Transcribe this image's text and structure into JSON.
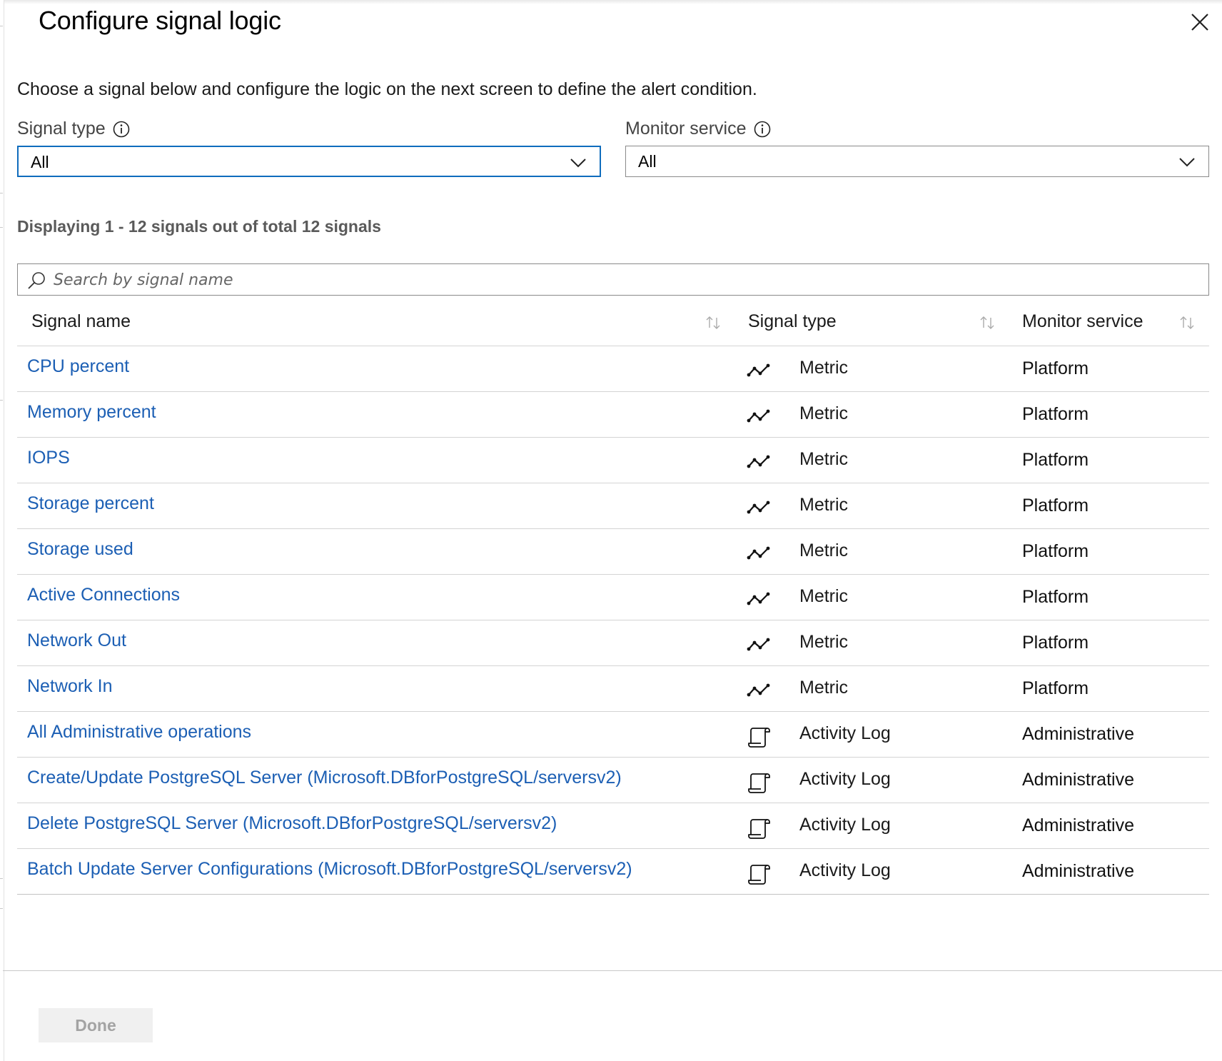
{
  "panel": {
    "title": "Configure signal logic",
    "intro": "Choose a signal below and configure the logic on the next screen to define the alert condition."
  },
  "filters": {
    "signal_type": {
      "label": "Signal type",
      "value": "All"
    },
    "monitor_service": {
      "label": "Monitor service",
      "value": "All"
    }
  },
  "results": {
    "count_text": "Displaying 1 - 12 signals out of total 12 signals"
  },
  "search": {
    "placeholder": "Search by signal name"
  },
  "table": {
    "columns": [
      "Signal name",
      "Signal type",
      "Monitor service"
    ],
    "rows": [
      {
        "name": "CPU percent",
        "type": "Metric",
        "type_icon": "metric-icon",
        "service": "Platform"
      },
      {
        "name": "Memory percent",
        "type": "Metric",
        "type_icon": "metric-icon",
        "service": "Platform"
      },
      {
        "name": "IOPS",
        "type": "Metric",
        "type_icon": "metric-icon",
        "service": "Platform"
      },
      {
        "name": "Storage percent",
        "type": "Metric",
        "type_icon": "metric-icon",
        "service": "Platform"
      },
      {
        "name": "Storage used",
        "type": "Metric",
        "type_icon": "metric-icon",
        "service": "Platform"
      },
      {
        "name": "Active Connections",
        "type": "Metric",
        "type_icon": "metric-icon",
        "service": "Platform"
      },
      {
        "name": "Network Out",
        "type": "Metric",
        "type_icon": "metric-icon",
        "service": "Platform"
      },
      {
        "name": "Network In",
        "type": "Metric",
        "type_icon": "metric-icon",
        "service": "Platform"
      },
      {
        "name": "All Administrative operations",
        "type": "Activity Log",
        "type_icon": "activity-log-icon",
        "service": "Administrative"
      },
      {
        "name": "Create/Update PostgreSQL Server (Microsoft.DBforPostgreSQL/serversv2)",
        "type": "Activity Log",
        "type_icon": "activity-log-icon",
        "service": "Administrative"
      },
      {
        "name": "Delete PostgreSQL Server (Microsoft.DBforPostgreSQL/serversv2)",
        "type": "Activity Log",
        "type_icon": "activity-log-icon",
        "service": "Administrative"
      },
      {
        "name": "Batch Update Server Configurations (Microsoft.DBforPostgreSQL/serversv2)",
        "type": "Activity Log",
        "type_icon": "activity-log-icon",
        "service": "Administrative"
      }
    ]
  },
  "footer": {
    "done_label": "Done"
  },
  "colors": {
    "link": "#1c5fb4",
    "focus_border": "#0f6cbd",
    "disabled_bg": "#f0f0f0",
    "disabled_text": "#a3a3a3"
  }
}
